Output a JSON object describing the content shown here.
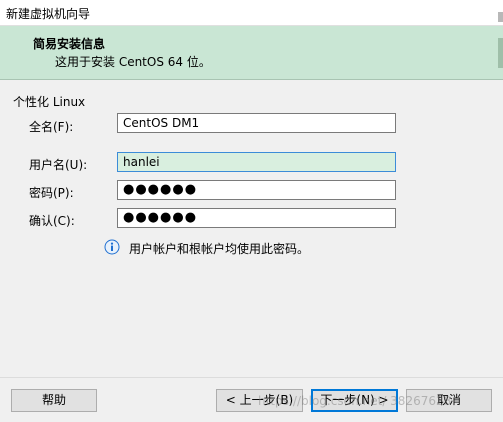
{
  "window": {
    "title": "新建虚拟机向导"
  },
  "header": {
    "title": "简易安装信息",
    "subtitle": "这用于安装 CentOS 64 位。"
  },
  "form": {
    "group_label": "个性化 Linux",
    "fullname": {
      "label": "全名(F):",
      "value": "CentOS DM1"
    },
    "username": {
      "label": "用户名(U):",
      "value": "hanlei"
    },
    "password": {
      "label": "密码(P):",
      "value": "●●●●●●"
    },
    "confirm": {
      "label": "确认(C):",
      "value": "●●●●●●"
    },
    "info_text": "用户帐户和根帐户均使用此密码。"
  },
  "buttons": {
    "help": "帮助",
    "back": "< 上一步(B)",
    "next": "下一步(N) >",
    "cancel": "取消"
  },
  "watermark": "https://blog.csdn.net/ 38267628",
  "colors": {
    "header_bg": "#c9e6d4",
    "active_field_bg": "#d9efdf",
    "primary_border": "#0078d7",
    "info_icon": "#1f6fd1"
  }
}
